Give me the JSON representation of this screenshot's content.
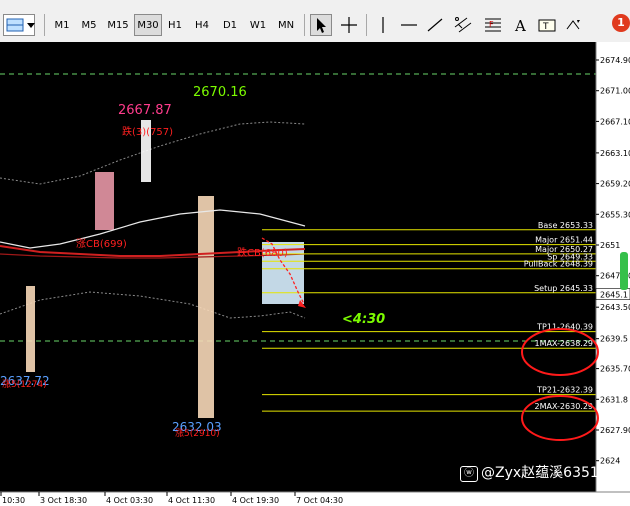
{
  "toolbar": {
    "timeframes": [
      "M1",
      "M5",
      "M15",
      "M30",
      "H1",
      "H4",
      "D1",
      "W1",
      "MN"
    ],
    "active_timeframe": "M30",
    "notification_count": "1"
  },
  "price_axis": [
    "2674.90",
    "2671.00",
    "2667.10",
    "2663.10",
    "2659.20",
    "2655.30",
    "2651",
    "2647.50",
    "2643.50",
    "2639.5",
    "2635.70",
    "2631.8",
    "2627.90",
    "2624"
  ],
  "time_axis": [
    "10:30",
    "3 Oct 18:30",
    "4 Oct 03:30",
    "4 Oct 11:30",
    "4 Oct 19:30",
    "7 Oct 04:30"
  ],
  "current_price": "2645.1",
  "countdown": "<4:30",
  "labels": {
    "high_left": "2667.87",
    "high_right": "2670.16",
    "low_left": "2637.72",
    "low_mid": "2632.03",
    "tag_fall_757": "跌(3)(757)",
    "tag_rise_699": "涨CB(699)",
    "tag_fall_right": "跌CB(680)",
    "tag_rise_left_low": "涨5(1274)",
    "tag_rise_mid_low": "涨5(2910)"
  },
  "levels": [
    {
      "label": "Base 2653.33",
      "price": 2653.33
    },
    {
      "label": "Major 2651.44",
      "price": 2651.44
    },
    {
      "label": "Major 2650.27",
      "price": 2650.27
    },
    {
      "label": "Sp 2649.33",
      "price": 2649.33
    },
    {
      "label": "PullBack 2648.39",
      "price": 2648.39
    },
    {
      "label": "Setup 2645.33",
      "price": 2645.33
    },
    {
      "label": "TP11-2640.39",
      "price": 2640.39
    },
    {
      "label": "1MAX-2638.29",
      "price": 2638.29
    },
    {
      "label": "TP21-2632.39",
      "price": 2632.39
    },
    {
      "label": "2MAX-2630.29",
      "price": 2630.29
    }
  ],
  "watermark": "@Zyx赵蕴溪6351",
  "colors": {
    "background": "#000000",
    "bull": "#00c800",
    "bear": "#ffffff",
    "level_line": "#e6e600",
    "ma_red": "#d02020",
    "dotted_band": "#8a8a8a",
    "accent_pink": "#ff3c8c",
    "accent_green": "#7cfc00",
    "accent_blue": "#5aa0ff",
    "circle": "#ff1a1a"
  }
}
